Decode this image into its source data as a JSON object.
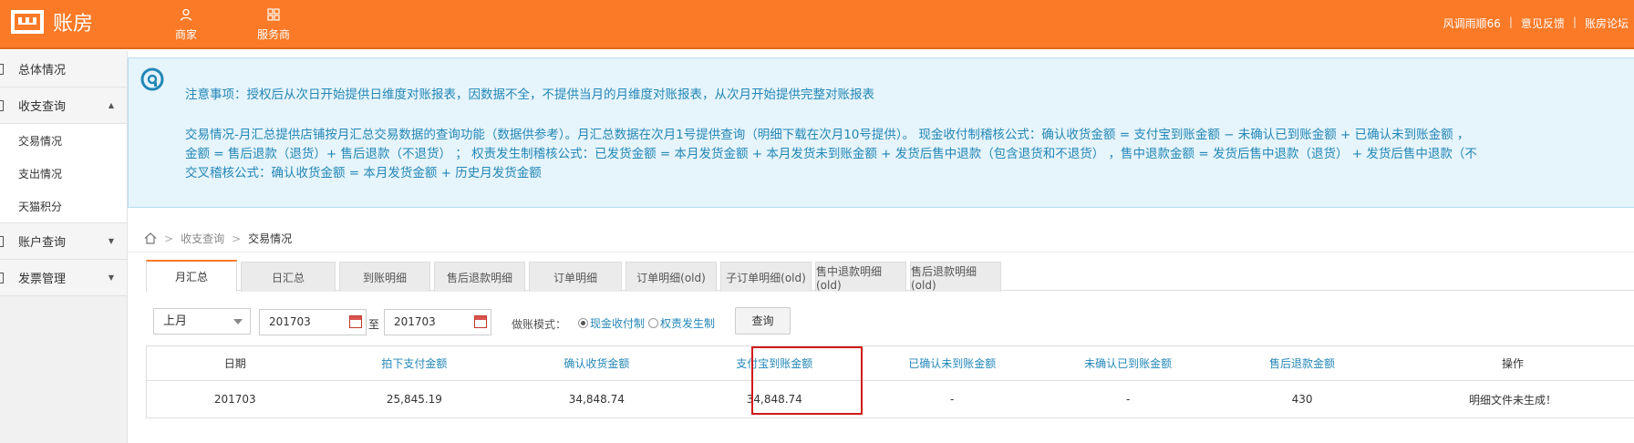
{
  "app": {
    "title": "账房"
  },
  "topnav": [
    {
      "label": "商家",
      "icon": "user-icon"
    },
    {
      "label": "服务商",
      "icon": "grid-icon"
    }
  ],
  "toplinks": {
    "user": "风调雨顺66",
    "feedback": "意见反馈",
    "forum": "账房论坛"
  },
  "sidebar": {
    "items": [
      {
        "label": "总体情况",
        "expanded": false
      },
      {
        "label": "收支查询",
        "expanded": true,
        "children": [
          {
            "label": "交易情况",
            "active": true
          },
          {
            "label": "支出情况"
          },
          {
            "label": "天猫积分"
          }
        ]
      },
      {
        "label": "账户查询",
        "expanded": false
      },
      {
        "label": "发票管理",
        "expanded": false
      }
    ]
  },
  "notice": {
    "line1": "注意事项：授权后从次日开始提供日维度对账报表，因数据不全，不提供当月的月维度对账报表，从次月开始提供完整对账报表",
    "para": [
      "交易情况-月汇总提供店铺按月汇总交易数据的查询功能（数据供参考）。月汇总数据在次月1号提供查询（明细下载在次月10号提供）。 现金收付制稽核公式：确认收货金额 = 支付宝到账金额 − 未确认已到账金额 + 已确认未到账金额 ，",
      "金额 = 售后退款（退货）+ 售后退款（不退货） ； 权责发生制稽核公式：已发货金额 = 本月发货金额 + 本月发货未到账金额 + 发货后售中退款（包含退货和不退货） ，售中退款金额 = 发货后售中退款（退货） + 发货后售中退款（不",
      "交叉稽核公式：确认收货金额 = 本月发货金额 + 历史月发货金额"
    ]
  },
  "breadcrumb": {
    "parent": "收支查询",
    "current": "交易情况"
  },
  "tabs": [
    "月汇总",
    "日汇总",
    "到账明细",
    "售后退款明细",
    "订单明细",
    "订单明细(old)",
    "子订单明细(old)",
    "售中退款明细(old)",
    "售后退款明细(old)"
  ],
  "active_tab": "月汇总",
  "filters": {
    "period": "上月",
    "from": "201703",
    "to_label": "至",
    "to": "201703",
    "mode_label": "做账模式：",
    "mode_cash": "现金收付制",
    "mode_accrual": "权责发生制",
    "mode_selected": "现金收付制",
    "query": "查询"
  },
  "table": {
    "headers": [
      "日期",
      "拍下支付金额",
      "确认收货金额",
      "支付宝到账金额",
      "已确认未到账金额",
      "未确认已到账金额",
      "售后退款金额",
      "操作"
    ],
    "rows": [
      [
        "201703",
        "25,845.19",
        "34,848.74",
        "34,848.74",
        "-",
        "-",
        "430",
        "明细文件未生成！"
      ]
    ]
  }
}
